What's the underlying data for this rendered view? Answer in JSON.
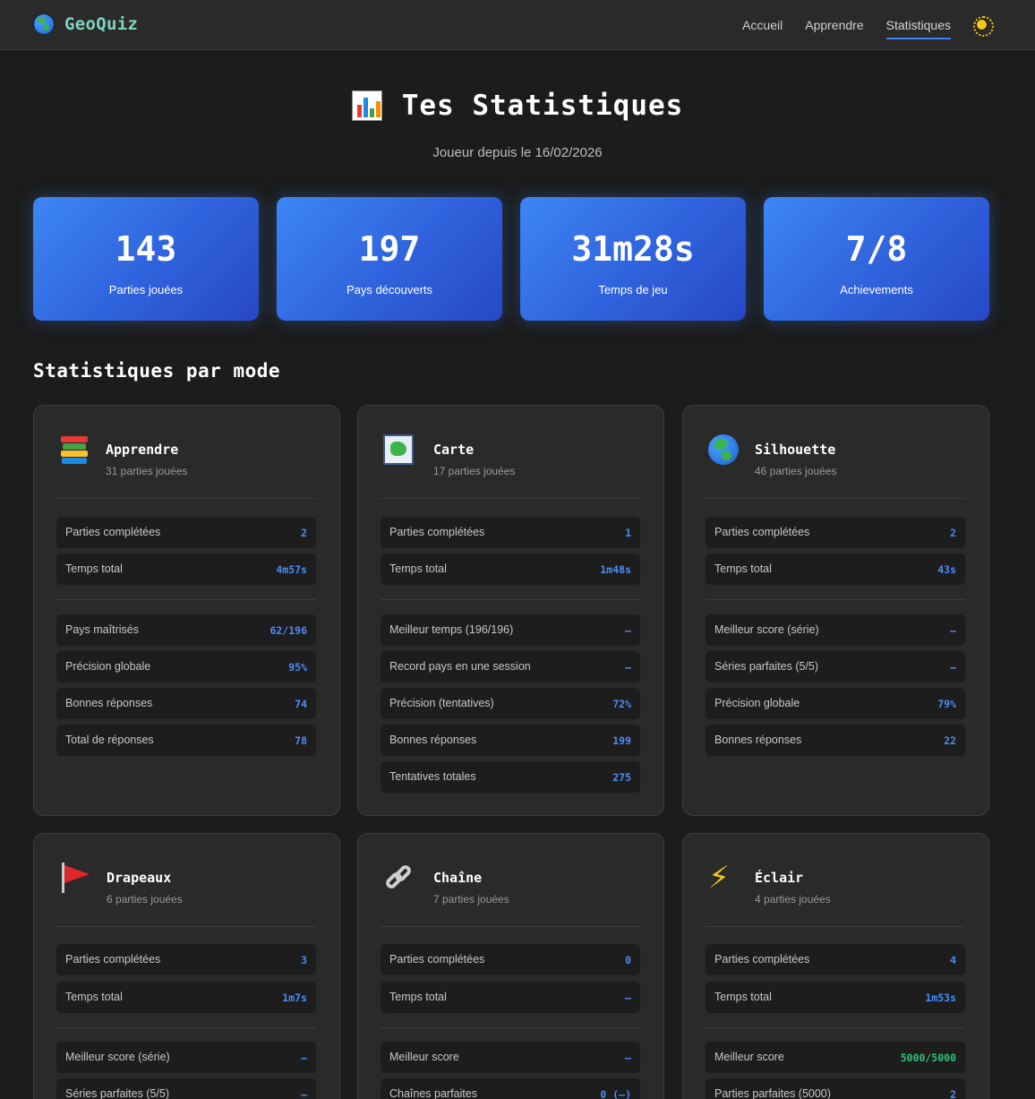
{
  "nav": {
    "brand": "GeoQuiz",
    "links": [
      {
        "label": "Accueil",
        "active": false
      },
      {
        "label": "Apprendre",
        "active": false
      },
      {
        "label": "Statistiques",
        "active": true
      }
    ],
    "theme_icon": "sun-icon"
  },
  "header": {
    "title": "Tes Statistiques",
    "subtitle": "Joueur depuis le 16/02/2026",
    "icon": "bar-chart-icon"
  },
  "summary": [
    {
      "value": "143",
      "label": "Parties jouées"
    },
    {
      "value": "197",
      "label": "Pays découverts"
    },
    {
      "value": "31m28s",
      "label": "Temps de jeu"
    },
    {
      "value": "7/8",
      "label": "Achievements"
    }
  ],
  "section_title": "Statistiques par mode",
  "modes": [
    {
      "name": "Apprendre",
      "sub": "31 parties jouées",
      "icon": "books-icon",
      "base": [
        {
          "label": "Parties complétées",
          "value": "2"
        },
        {
          "label": "Temps total",
          "value": "4m57s"
        }
      ],
      "extra": [
        {
          "label": "Pays maîtrisés",
          "value": "62/196"
        },
        {
          "label": "Précision globale",
          "value": "95%"
        },
        {
          "label": "Bonnes réponses",
          "value": "74"
        },
        {
          "label": "Total de réponses",
          "value": "78"
        }
      ]
    },
    {
      "name": "Carte",
      "sub": "17 parties jouées",
      "icon": "map-icon",
      "base": [
        {
          "label": "Parties complétées",
          "value": "1"
        },
        {
          "label": "Temps total",
          "value": "1m48s"
        }
      ],
      "extra": [
        {
          "label": "Meilleur temps (196/196)",
          "value": "–"
        },
        {
          "label": "Record pays en une session",
          "value": "–"
        },
        {
          "label": "Précision (tentatives)",
          "value": "72%"
        },
        {
          "label": "Bonnes réponses",
          "value": "199"
        },
        {
          "label": "Tentatives totales",
          "value": "275"
        }
      ]
    },
    {
      "name": "Silhouette",
      "sub": "46 parties jouées",
      "icon": "globe-icon",
      "base": [
        {
          "label": "Parties complétées",
          "value": "2"
        },
        {
          "label": "Temps total",
          "value": "43s"
        }
      ],
      "extra": [
        {
          "label": "Meilleur score (série)",
          "value": "–"
        },
        {
          "label": "Séries parfaites (5/5)",
          "value": "–"
        },
        {
          "label": "Précision globale",
          "value": "79%"
        },
        {
          "label": "Bonnes réponses",
          "value": "22"
        }
      ]
    },
    {
      "name": "Drapeaux",
      "sub": "6 parties jouées",
      "icon": "flag-icon",
      "base": [
        {
          "label": "Parties complétées",
          "value": "3"
        },
        {
          "label": "Temps total",
          "value": "1m7s"
        }
      ],
      "extra": [
        {
          "label": "Meilleur score (série)",
          "value": "–"
        },
        {
          "label": "Séries parfaites (5/5)",
          "value": "–"
        }
      ]
    },
    {
      "name": "Chaîne",
      "sub": "7 parties jouées",
      "icon": "link-icon",
      "base": [
        {
          "label": "Parties complétées",
          "value": "0"
        },
        {
          "label": "Temps total",
          "value": "–"
        }
      ],
      "extra": [
        {
          "label": "Meilleur score",
          "value": "–"
        },
        {
          "label": "Chaînes parfaites",
          "value": "0 (–)"
        }
      ]
    },
    {
      "name": "Éclair",
      "sub": "4 parties jouées",
      "icon": "lightning-icon",
      "base": [
        {
          "label": "Parties complétées",
          "value": "4"
        },
        {
          "label": "Temps total",
          "value": "1m53s"
        }
      ],
      "extra": [
        {
          "label": "Meilleur score",
          "value": "5000/5000",
          "color": "#2fc27a"
        },
        {
          "label": "Parties parfaites (5000)",
          "value": "2"
        }
      ]
    }
  ],
  "colors": {
    "accent": "#3b82f6",
    "value_blue": "#4b8cf7",
    "value_green": "#2fc27a",
    "brand": "#7fd3bf"
  }
}
